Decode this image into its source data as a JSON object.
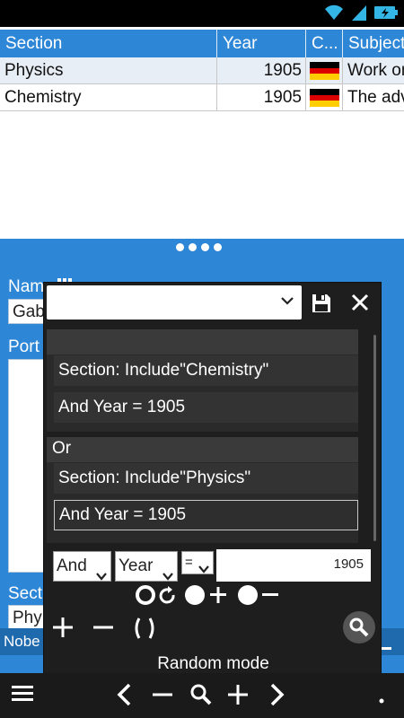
{
  "colors": {
    "accent": "#2e86d6",
    "dialog_bg": "#1e1e1e",
    "status_bar": "#000000",
    "nav_bar": "#1a1a1a"
  },
  "status_bar": {
    "icons": [
      "wifi-icon",
      "signal-icon",
      "battery-charging-icon"
    ]
  },
  "table": {
    "columns": [
      "Section",
      "Year",
      "C...",
      "Subject"
    ],
    "rows": [
      {
        "section": "Physics",
        "year": "1905",
        "country_flag": "germany-flag-icon",
        "subject": "Work on"
      },
      {
        "section": "Chemistry",
        "year": "1905",
        "country_flag": "germany-flag-icon",
        "subject": "The adv"
      }
    ]
  },
  "form": {
    "name_label": "Nam",
    "name_value": "Gab",
    "portrait_label": "Port",
    "section_label": "Sect",
    "section_value": "Phy",
    "nobel_bar_text": "Nobe"
  },
  "filter_dialog": {
    "saved_filter_value": "",
    "group1": {
      "header": "",
      "conditions": [
        "Section: Include\"Chemistry\"",
        "And Year = 1905"
      ]
    },
    "group2": {
      "header": "Or",
      "conditions": [
        "Section: Include\"Physics\"",
        "And Year = 1905"
      ]
    },
    "editor": {
      "logic_value": "And",
      "field_value": "Year",
      "operator_value": "=",
      "value": "1905"
    },
    "random_mode_label": "Random mode"
  },
  "bottom_nav": {
    "icons": [
      "menu-icon",
      "previous-icon",
      "zoom-out-icon",
      "search-icon",
      "zoom-in-icon",
      "next-icon",
      "more-icon"
    ]
  }
}
